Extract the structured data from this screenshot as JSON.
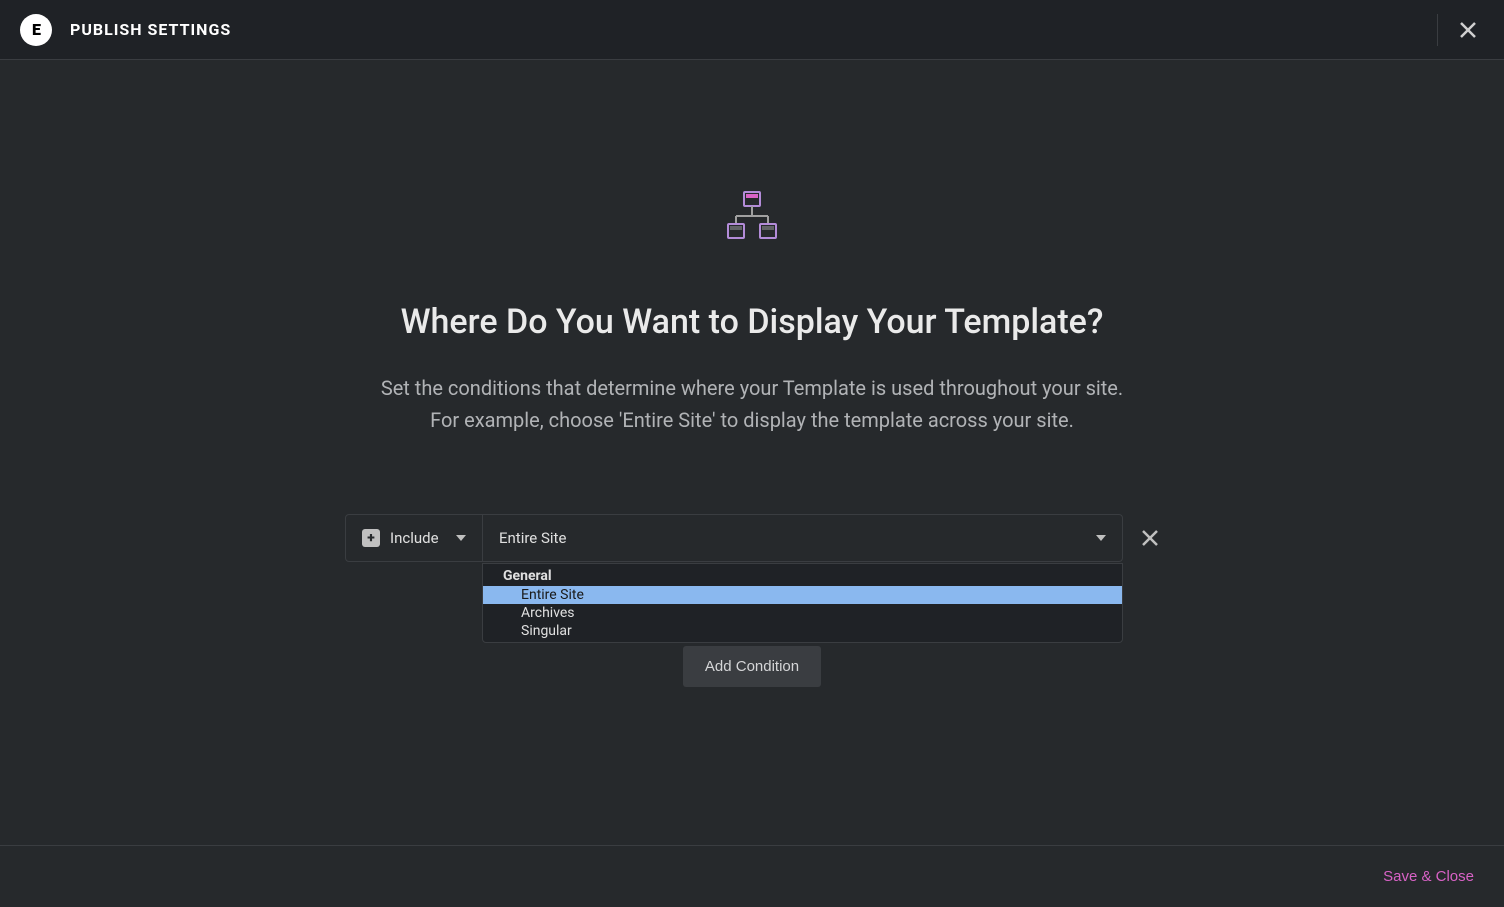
{
  "header": {
    "title": "PUBLISH SETTINGS"
  },
  "main": {
    "heading": "Where Do You Want to Display Your Template?",
    "description_line1": "Set the conditions that determine where your Template is used throughout your site.",
    "description_line2": "For example, choose 'Entire Site' to display the template across your site."
  },
  "condition": {
    "include_label": "Include",
    "scope_selected": "Entire Site"
  },
  "dropdown": {
    "group_label": "General",
    "items": [
      "Entire Site",
      "Archives",
      "Singular"
    ],
    "selected_index": 0
  },
  "buttons": {
    "add_condition": "Add Condition",
    "save_close": "Save & Close"
  }
}
